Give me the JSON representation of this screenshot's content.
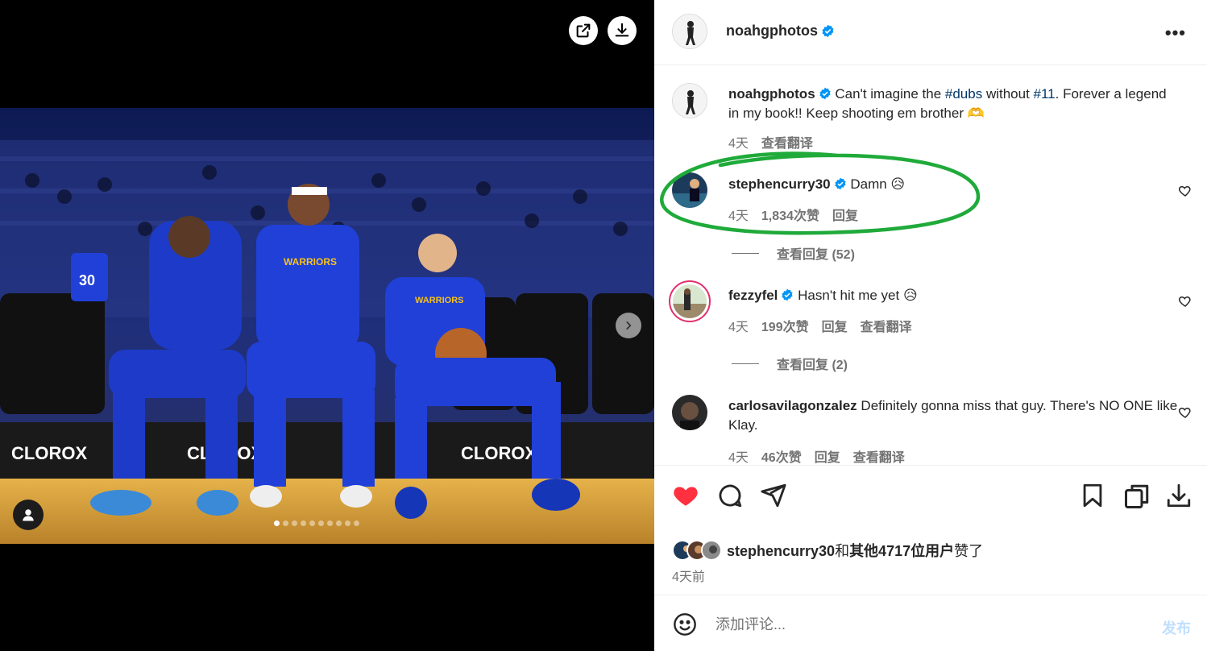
{
  "post": {
    "author": "noahgphotos",
    "caption_text_1": "Can't imagine the ",
    "hashtag": "#dubs",
    "caption_text_2": " without ",
    "mention": "#11",
    "caption_text_3": ". Forever a legend in my book!! Keep shooting em brother 🫶",
    "caption_time": "4天",
    "caption_translate": "查看翻译"
  },
  "comments": [
    {
      "user": "stephencurry30",
      "text": "Damn 😥",
      "time": "4天",
      "likes": "1,834次赞",
      "reply": "回复",
      "view_replies": "查看回复 (52)"
    },
    {
      "user": "fezzyfel",
      "text": "Hasn't hit me yet 😥",
      "time": "4天",
      "likes": "199次赞",
      "reply": "回复",
      "translate": "查看翻译",
      "view_replies": "查看回复 (2)"
    },
    {
      "user": "carlosavilagonzalez",
      "text": "Definitely gonna miss that guy. There's NO ONE like Klay.",
      "time": "4天",
      "likes": "46次赞",
      "reply": "回复",
      "translate": "查看翻译"
    }
  ],
  "likes_summary": {
    "user": "stephencurry30",
    "and": "和",
    "others": "其他4717位用户",
    "liked": "赞了"
  },
  "post_time": "4天前",
  "add_comment": {
    "placeholder": "添加评论...",
    "post_label": "发布"
  },
  "carousel": {
    "count": 10,
    "active": 0
  },
  "photo": {
    "jersey_text": "WARRIORS",
    "sponsor_text": "CLOROX",
    "jersey_number": "30"
  },
  "colors": {
    "like_red": "#ff3040",
    "verified_blue": "#0095f6",
    "annotation_green": "#1faa3a",
    "court_wood": "#d9a23a"
  },
  "icons": [
    "share-external-icon",
    "download-icon",
    "chevron-right-icon",
    "user-tag-icon",
    "verified-badge-icon",
    "more-options-icon",
    "heart-filled-icon",
    "heart-outline-icon",
    "comment-icon",
    "share-icon",
    "bookmark-icon",
    "copy-icon",
    "download-icon",
    "emoji-icon"
  ]
}
